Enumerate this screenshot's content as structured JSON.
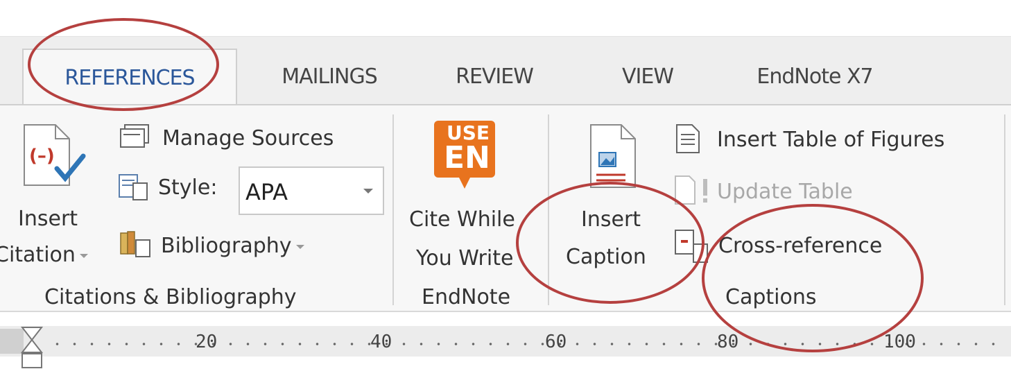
{
  "tabs": [
    "REFERENCES",
    "MAILINGS",
    "REVIEW",
    "VIEW",
    "EndNote X7"
  ],
  "citations": {
    "insert_citation_line1": "Insert",
    "insert_citation_line2": "Citation",
    "manage_sources": "Manage Sources",
    "style_label": "Style:",
    "style_value": "APA",
    "bibliography": "Bibliography",
    "group_label": "Citations & Bibliography"
  },
  "endnote": {
    "badge_top": "USE",
    "badge_bottom": "EN",
    "cite_line1": "Cite While",
    "cite_line2": "You Write",
    "group_label": "EndNote"
  },
  "captions": {
    "insert_caption_line1": "Insert",
    "insert_caption_line2": "Caption",
    "insert_table_of_figures": "Insert Table of Figures",
    "update_table": "Update Table",
    "cross_reference": "Cross-reference",
    "group_label": "Captions"
  },
  "ruler": {
    "labels": [
      "20",
      "40",
      "60",
      "80",
      "100"
    ]
  },
  "annotation_color": "#b5403f",
  "accent_color": "#2b579a",
  "endnote_color": "#e8731e"
}
